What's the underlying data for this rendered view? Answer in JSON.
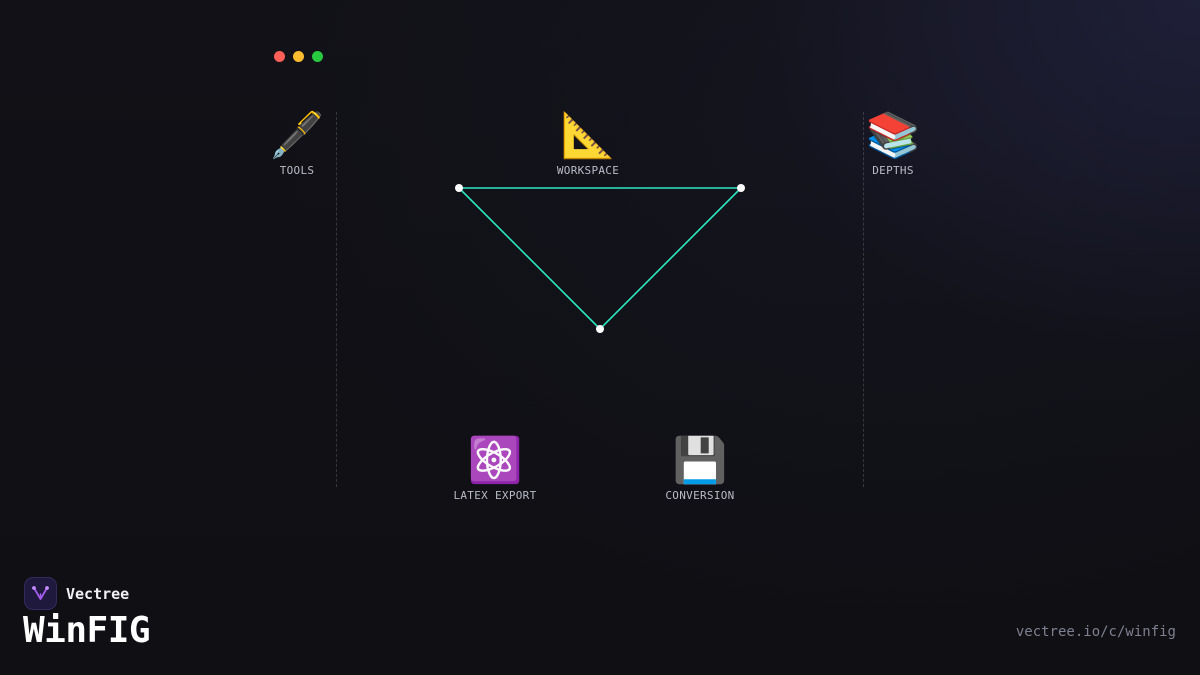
{
  "window_controls": {
    "close_color": "#ff5f57",
    "minimize_color": "#febc2e",
    "maximize_color": "#28c840"
  },
  "nodes": {
    "tools": {
      "icon": "🖋️",
      "icon_name": "fountain-pen-icon",
      "label": "TOOLS"
    },
    "workspace": {
      "icon": "📐",
      "icon_name": "triangular-ruler-icon",
      "label": "WORKSPACE"
    },
    "depths": {
      "icon": "📚",
      "icon_name": "books-icon",
      "label": "DEPTHS"
    },
    "latex_export": {
      "icon": "⚛️",
      "icon_name": "atom-icon",
      "label": "LATEX EXPORT"
    },
    "conversion": {
      "icon": "💾",
      "icon_name": "floppy-disk-icon",
      "label": "CONVERSION"
    }
  },
  "diagram": {
    "stroke_color": "#2ee6c0",
    "vertex_color": "#ffffff"
  },
  "brand": {
    "name": "Vectree",
    "logo_icon": "vectree-logo-icon",
    "logo_color": "#a45cf0"
  },
  "app": {
    "title": "WinFIG"
  },
  "footer": {
    "url": "vectree.io/c/winfig"
  }
}
